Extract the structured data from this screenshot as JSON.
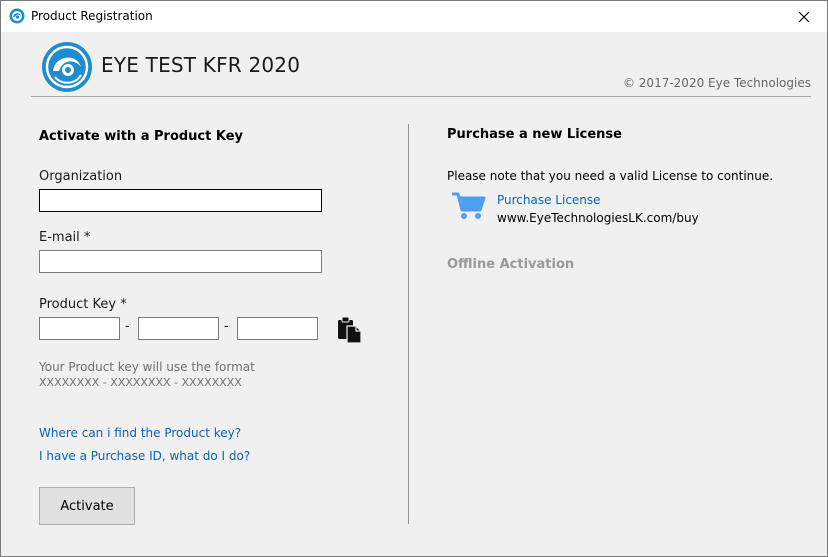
{
  "window": {
    "title": "Product Registration"
  },
  "header": {
    "product_name": "EYE TEST KFR 2020",
    "copyright": "© 2017-2020 Eye Technologies"
  },
  "left": {
    "section_title": "Activate with a Product Key",
    "organization_label": "Organization",
    "organization_value": "",
    "email_label": "E-mail *",
    "email_value": "",
    "product_key_label": "Product Key *",
    "key_part_1": "",
    "key_part_2": "",
    "key_part_3": "",
    "key_separator": "-",
    "format_hint": "Your Product key will use the format",
    "format_example": "XXXXXXXX - XXXXXXXX - XXXXXXXX",
    "find_key_link": "Where can i find the Product key?",
    "purchase_id_link": "I have a Purchase ID, what do I do?",
    "activate_button": "Activate"
  },
  "right": {
    "section_title": "Purchase a new License",
    "notice": "Please note that you need a valid License to continue.",
    "purchase_link": "Purchase License",
    "purchase_url": "www.EyeTechnologiesLK.com/buy",
    "offline_activation": "Offline Activation"
  },
  "icons": {
    "app": "eye-logo-icon",
    "close": "close-icon",
    "paste": "clipboard-paste-icon",
    "cart": "shopping-cart-icon"
  },
  "colors": {
    "link": "#0b62b5",
    "cart": "#4f9ef6",
    "logo": "#1f8ccf",
    "disabled_text": "#9a9a9a"
  }
}
